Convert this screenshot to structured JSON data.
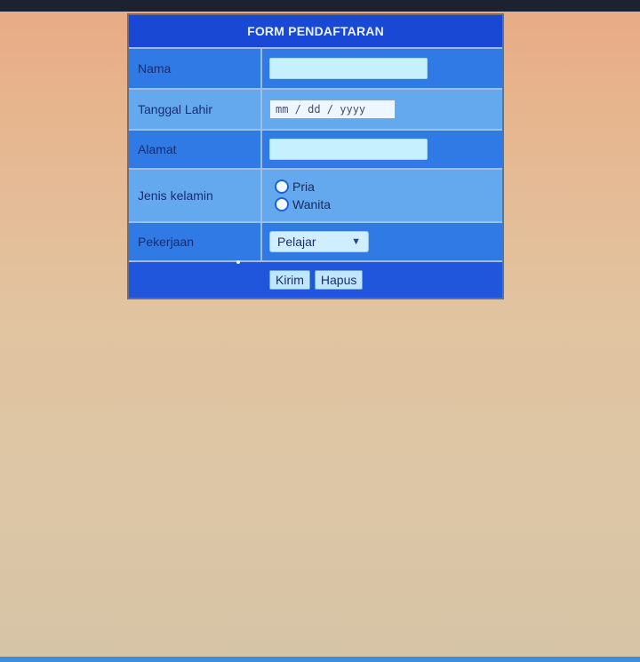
{
  "form": {
    "title": "FORM PENDAFTARAN",
    "fields": {
      "nama_label": "Nama",
      "tanggal_label": "Tanggal Lahir",
      "tanggal_placeholder": "mm / dd / yyyy",
      "alamat_label": "Alamat",
      "jenis_label": "Jenis kelamin",
      "gender_options": [
        "Pria",
        "Wanita"
      ],
      "pekerjaan_label": "Pekerjaan",
      "pekerjaan_value": "Pelajar"
    },
    "buttons": {
      "submit": "Kirim",
      "reset": "Hapus"
    }
  },
  "colors": {
    "header": "#1848d4",
    "row_dark": "#2f7ae5",
    "row_light": "#64a8ee",
    "button_row": "#1f56dc"
  },
  "icons": {
    "select": "chevron-down-icon",
    "radio": "radio-circle-icon"
  }
}
